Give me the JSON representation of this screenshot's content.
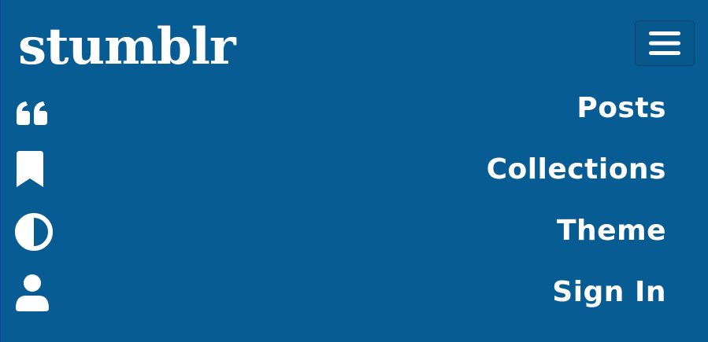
{
  "header": {
    "logo_text": "stumblr",
    "menu_toggle_icon": "hamburger-icon"
  },
  "nav": {
    "items": [
      {
        "label": "Posts",
        "icon": "quote-icon"
      },
      {
        "label": "Collections",
        "icon": "bookmark-icon"
      },
      {
        "label": "Theme",
        "icon": "contrast-icon"
      },
      {
        "label": "Sign In",
        "icon": "user-icon"
      }
    ]
  },
  "colors": {
    "background": "#075c93",
    "text": "#ffffff"
  }
}
